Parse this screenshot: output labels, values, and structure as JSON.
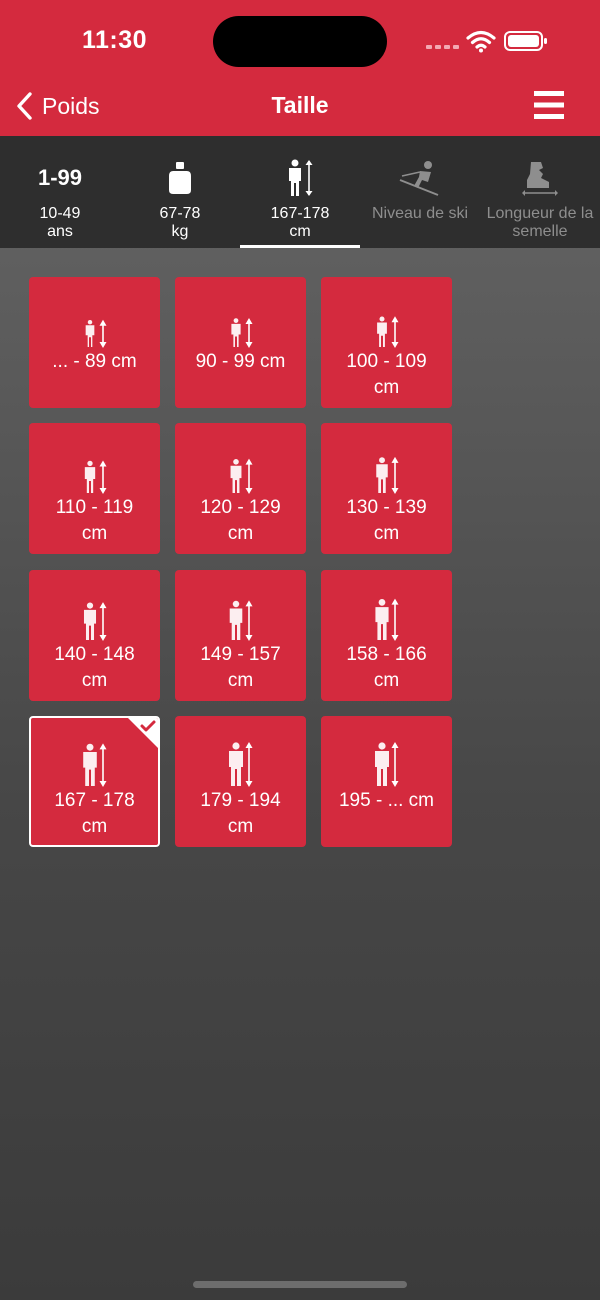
{
  "status": {
    "time": "11:30"
  },
  "nav": {
    "back_label": "Poids",
    "title": "Taille"
  },
  "tabs": [
    {
      "icon_text": "1-99",
      "icon": "age-icon",
      "label": "10-49 ans",
      "enabled": true
    },
    {
      "icon": "weight-icon",
      "label": "67-78 kg",
      "enabled": true
    },
    {
      "icon": "height-icon",
      "label": "167-178 cm",
      "enabled": true,
      "active": true
    },
    {
      "icon": "skier-icon",
      "label": "Niveau de ski",
      "enabled": false
    },
    {
      "icon": "ski-boot-icon",
      "label": "Longueur de la semelle",
      "enabled": false
    }
  ],
  "sizes": [
    {
      "label": "... - 89 cm",
      "icon_scale": 0.62
    },
    {
      "label": "90 - 99 cm",
      "icon_scale": 0.66
    },
    {
      "label": "100 - 109 cm",
      "icon_scale": 0.7
    },
    {
      "label": "110 - 119 cm",
      "icon_scale": 0.74
    },
    {
      "label": "120 - 129 cm",
      "icon_scale": 0.78
    },
    {
      "label": "130 - 139 cm",
      "icon_scale": 0.82
    },
    {
      "label": "140 - 148 cm",
      "icon_scale": 0.86
    },
    {
      "label": "149 - 157 cm",
      "icon_scale": 0.9
    },
    {
      "label": "158 - 166 cm",
      "icon_scale": 0.94
    },
    {
      "label": "167 - 178 cm",
      "icon_scale": 0.97,
      "selected": true
    },
    {
      "label": "179 - 194 cm",
      "icon_scale": 1.0
    },
    {
      "label": "195 - ... cm",
      "icon_scale": 1.0
    }
  ],
  "colors": {
    "accent": "#d42a3e",
    "tab_bar": "#2e2e2e",
    "disabled": "#8e8e8e"
  }
}
